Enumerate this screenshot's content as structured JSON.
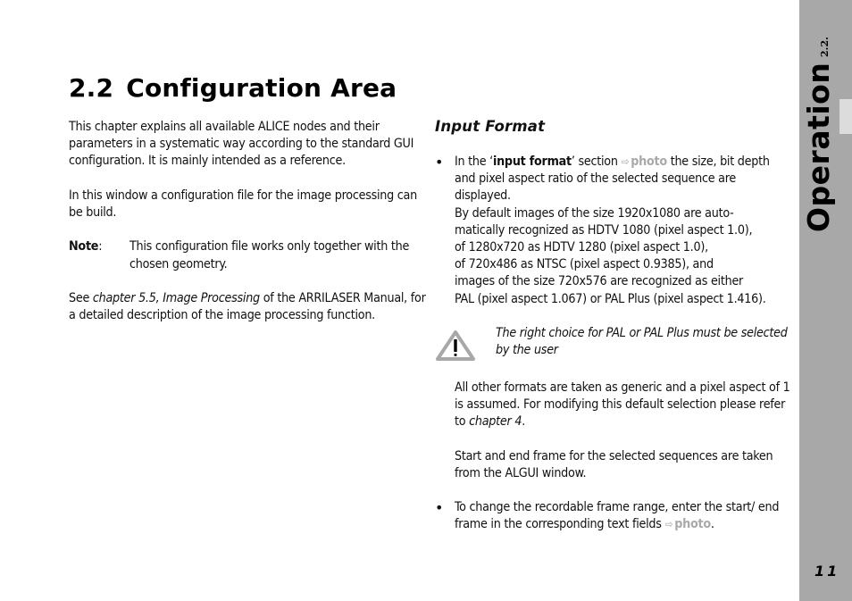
{
  "header": {
    "section_number": "2.2",
    "title": "Configuration Area"
  },
  "left_column": {
    "intro": "This chapter explains all available ALICE nodes and their parameters in a systematic way according to the standard GUI configuration. It is mainly intended as a reference.",
    "window_desc": "In this window a configuration file for the image processing can be build.",
    "note": {
      "label": "Note",
      "colon": ":",
      "text": "This configuration file works only together with the chosen geometry."
    },
    "see": {
      "prefix": "See ",
      "ref": "chapter 5.5, Image Processing",
      "suffix": " of the ARRILASER Manual, for a detailed description of the image processing function."
    }
  },
  "right_column": {
    "heading": "Input Format",
    "bullet_char": "•",
    "bullet1": {
      "pre": "In the ‘",
      "term": "input format",
      "post_term": "’ section ",
      "photo_arrow": "⇨",
      "photo_label": "photo",
      "rest": " the size, bit depth and pixel aspect ratio of the selected sequence are displayed."
    },
    "defaults_lines": [
      "By default images of the size 1920x1080 are auto-",
      "matically recognized as HDTV 1080 (pixel aspect 1.0),",
      "of 1280x720 as HDTV 1280 (pixel aspect 1.0),",
      "of 720x486 as NTSC (pixel aspect 0.9385),  and",
      "images of the size 720x576 are recognized as either",
      "PAL (pixel aspect 1.067) or PAL Plus (pixel aspect 1.416)."
    ],
    "warning": {
      "icon": "warning-triangle-icon",
      "text": "The right choice for PAL or PAL Plus must be selected by the user"
    },
    "generic": {
      "text": "All other formats are taken as generic and a pixel aspect of 1 is assumed. For modifying this default selection please refer to ",
      "ref": "chapter 4",
      "end": "."
    },
    "frames": "Start and end frame for the selected sequences are taken from the ALGUI window.",
    "bullet2": {
      "text": "To change the recordable frame range, enter the start/ end frame in the corresponding text fields ",
      "photo_arrow": "⇨",
      "photo_label": "photo",
      "end": "."
    }
  },
  "sidebar": {
    "chapter_title": "Operation",
    "section": "2.2."
  },
  "footer": {
    "page_number": "11"
  },
  "colors": {
    "sidebar_bg": "#a8a8a8",
    "sidebar_tab": "#dcdcdc",
    "photo_ref": "#a9a9a9"
  }
}
